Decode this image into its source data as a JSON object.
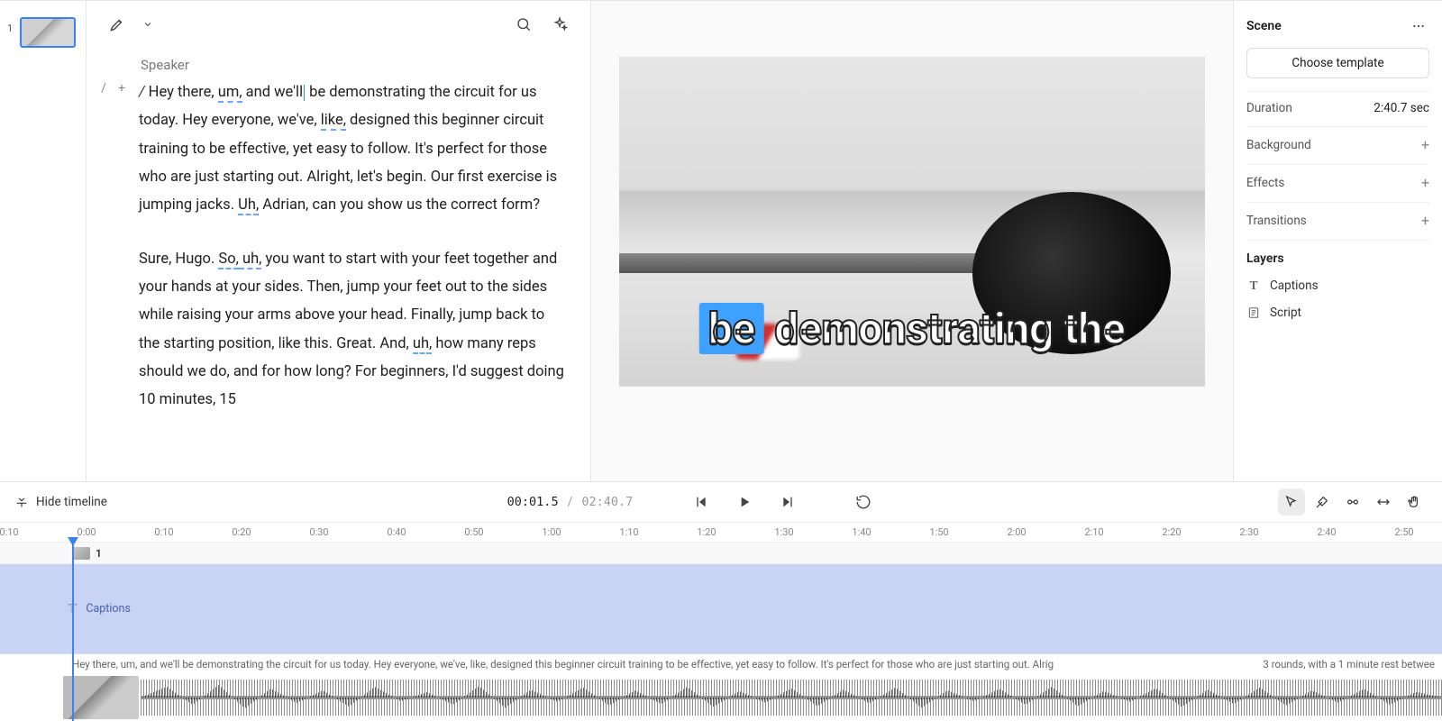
{
  "thumbs": {
    "first_num": "1"
  },
  "transcript": {
    "speaker": "Speaker",
    "p1_lead": "/ ",
    "p1_a": "Hey there, ",
    "p1_f1": "um,",
    "p1_b": " and we'll",
    "p1_c": " be demonstrating the circuit for us today. Hey everyone, we've, ",
    "p1_f2": "like,",
    "p1_d": " designed this beginner circuit training to be effective, yet easy to follow. It's perfect for those who are just starting out. Alright, let's begin. Our first exercise is jumping jacks. ",
    "p1_f3": "Uh,",
    "p1_e": " Adrian, can you show us the correct form?",
    "p2_a": "Sure, Hugo. ",
    "p2_f1": "So,",
    "p2_f2": " uh,",
    "p2_b": " you want to start with your feet together and your hands at your sides. Then, jump your feet out to the sides while raising your arms above your head. Finally, jump back to the starting position, like this. Great. And, ",
    "p2_f3": "uh,",
    "p2_c": " how many reps should we do, and for how long? For beginners, I'd suggest doing 10 minutes, 15"
  },
  "caption": {
    "highlight": "be",
    "rest": " demonstrating the"
  },
  "props": {
    "title": "Scene",
    "choose_template": "Choose template",
    "duration_label": "Duration",
    "duration_value": "2:40.7 sec",
    "background": "Background",
    "effects": "Effects",
    "transitions": "Transitions",
    "layers_header": "Layers",
    "layer_captions": "Captions",
    "layer_script": "Script"
  },
  "timeline": {
    "hide": "Hide timeline",
    "current": "00:01.5",
    "sep": "/",
    "duration": "02:40.7",
    "ruler": [
      "0:10",
      "0:00",
      "0:10",
      "0:20",
      "0:30",
      "0:40",
      "0:50",
      "1:00",
      "1:10",
      "1:20",
      "1:30",
      "1:40",
      "1:50",
      "2:00",
      "2:10",
      "2:20",
      "2:30",
      "2:40",
      "2:50"
    ],
    "scene_label": "1",
    "captions_label": "Captions",
    "text_a": "Hey there, um, and we'll be demonstrating the circuit for us today. Hey everyone, we've, like, designed this beginner circuit training to be effective, yet easy to follow. It's perfect for those who are just starting out. Alrig",
    "text_b": "3 rounds, with a 1 minute rest betwee"
  }
}
